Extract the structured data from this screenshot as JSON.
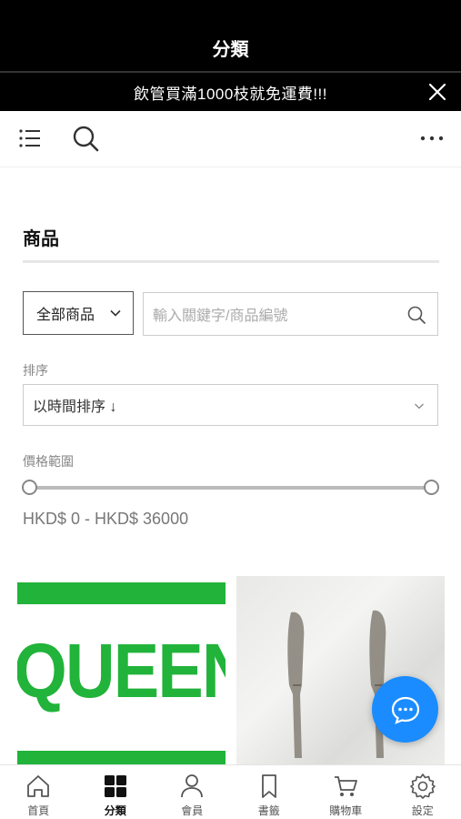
{
  "header": {
    "title": "分類"
  },
  "promo": {
    "text": "飲管買滿1000枝就免運費!!!"
  },
  "section": {
    "title": "商品"
  },
  "filters": {
    "category_selected": "全部商品",
    "search_placeholder": "輸入關鍵字/商品編號",
    "sort_label": "排序",
    "sort_selected": "以時間排序 ↓",
    "price_label": "價格範圍",
    "price_range_text": "HKD$ 0 - HKD$ 36000"
  },
  "products": [
    {
      "logo_text": "QUEEN",
      "accent": "#21b33a"
    },
    {
      "image": "cutlery-knives-photo"
    }
  ],
  "colors": {
    "fab": "#1a8cff",
    "brand_green": "#21b33a"
  },
  "bottom_nav": [
    {
      "label": "首頁",
      "icon": "home-icon"
    },
    {
      "label": "分類",
      "icon": "grid-icon",
      "active": true
    },
    {
      "label": "會員",
      "icon": "user-icon"
    },
    {
      "label": "書籤",
      "icon": "bookmark-icon"
    },
    {
      "label": "購物車",
      "icon": "cart-icon"
    },
    {
      "label": "設定",
      "icon": "gear-icon"
    }
  ]
}
